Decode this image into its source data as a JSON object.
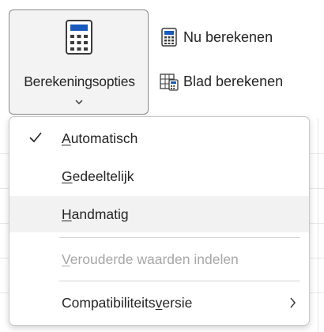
{
  "ribbon": {
    "calc_options": {
      "label": "Berekeningsopties",
      "icon": "calculator-icon"
    },
    "calc_now": {
      "label": "Nu berekenen",
      "icon": "calculator-small-icon"
    },
    "calc_sheet": {
      "label": "Blad berekenen",
      "icon": "calculate-sheet-icon"
    }
  },
  "menu": {
    "items": [
      {
        "first": "A",
        "rest": "utomatisch",
        "checked": true,
        "disabled": false
      },
      {
        "first": "G",
        "rest": "edeeltelijk",
        "checked": false,
        "disabled": false
      },
      {
        "first": "H",
        "rest": "andmatig",
        "checked": false,
        "disabled": false,
        "hover": true
      },
      {
        "first": "V",
        "rest": "erouderde waarden indelen",
        "checked": false,
        "disabled": true
      },
      {
        "pre": "Compatibiliteits",
        "first": "v",
        "rest": "ersie",
        "checked": false,
        "disabled": false,
        "submenu": true
      }
    ]
  },
  "colors": {
    "accent": "#185abd",
    "hover_bg": "#f2f2f2",
    "disabled_text": "#a6a6a6"
  }
}
